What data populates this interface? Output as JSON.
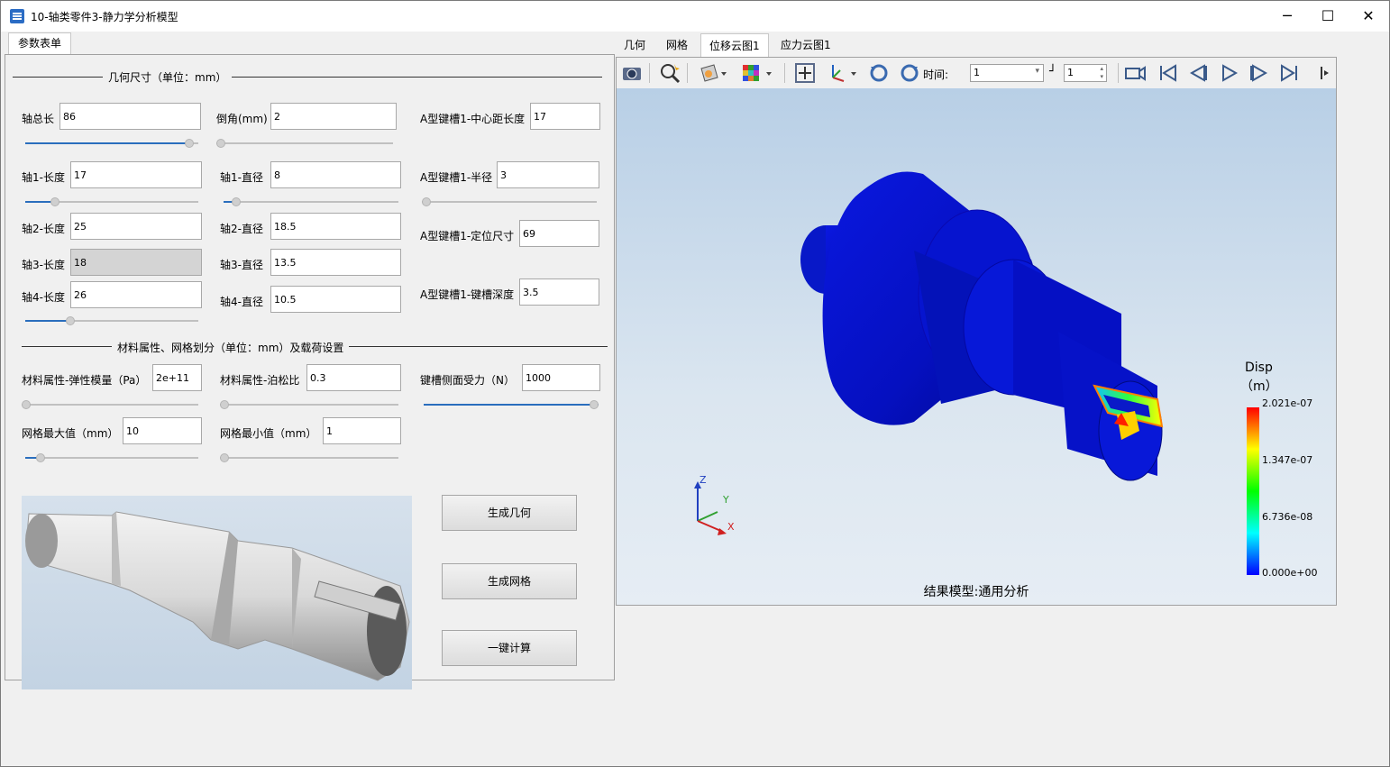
{
  "window": {
    "title": "10-轴类零件3-静力学分析模型",
    "minimize": "─",
    "maximize": "☐",
    "close": "✕"
  },
  "left_tab": "参数表单",
  "geometry_section": {
    "title": "几何尺寸（单位：mm）",
    "fields": [
      {
        "label": "轴总长",
        "value": "86",
        "slider_fraction": 0.95
      },
      {
        "label": "倒角(mm)",
        "value": "2",
        "slider_fraction": 0.0
      },
      {
        "label": "A型键槽1-中心距长度",
        "value": "17"
      },
      {
        "label": "轴1-长度",
        "value": "17",
        "slider_fraction": 0.17
      },
      {
        "label": "轴1-直径",
        "value": "8",
        "slider_fraction": 0.07
      },
      {
        "label": "A型键槽1-半径",
        "value": "3",
        "slider_fraction": 0.0
      },
      {
        "label": "轴2-长度",
        "value": "25"
      },
      {
        "label": "轴2-直径",
        "value": "18.5"
      },
      {
        "label": "A型键槽1-定位尺寸",
        "value": "69"
      },
      {
        "label": "轴3-长度",
        "value": "18"
      },
      {
        "label": "轴3-直径",
        "value": "13.5"
      },
      {
        "label": "轴4-长度",
        "value": "26",
        "slider_fraction": 0.26
      },
      {
        "label": "轴4-直径",
        "value": "10.5"
      },
      {
        "label": "A型键槽1-键槽深度",
        "value": "3.5"
      }
    ]
  },
  "material_section": {
    "title": "材料属性、网格划分（单位：mm）及载荷设置",
    "fields": [
      {
        "label": "材料属性-弹性模量（Pa）",
        "value": "2e+11",
        "slider_fraction": 0.0
      },
      {
        "label": "材料属性-泊松比",
        "value": "0.3",
        "slider_fraction": 0.0
      },
      {
        "label": "键槽侧面受力（N）",
        "value": "1000",
        "slider_fraction": 1.0
      },
      {
        "label": "网格最大值（mm）",
        "value": "10",
        "slider_fraction": 0.09
      },
      {
        "label": "网格最小值（mm）",
        "value": "1",
        "slider_fraction": 0.0
      }
    ]
  },
  "buttons": {
    "gen_geometry": "生成几何",
    "gen_mesh": "生成网格",
    "compute": "一键计算"
  },
  "right_tabs": [
    "几何",
    "网格",
    "位移云图1",
    "应力云图1"
  ],
  "toolbar": {
    "time_label": "时间:",
    "time_value": "1",
    "frame_value": "1"
  },
  "legend": {
    "title_line1": "Disp",
    "title_line2": "（m）",
    "max": "2.021e-07",
    "v2": "1.347e-07",
    "v3": "6.736e-08",
    "min": "0.000e+00"
  },
  "axes": {
    "z": "Z",
    "y": "Y",
    "x": "X"
  },
  "caption": "结果模型:通用分析",
  "colors": {
    "accent": "#2a6ebd",
    "model_blue": "#0a14d2"
  }
}
